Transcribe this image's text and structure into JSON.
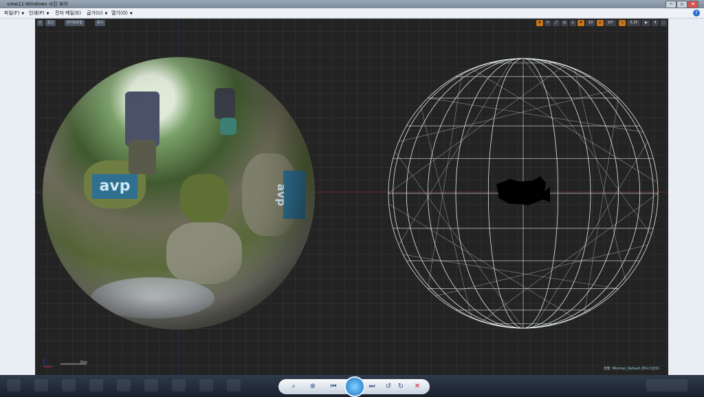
{
  "window": {
    "title": "view11-Windows 사진 뷰어"
  },
  "menu": {
    "items": [
      "파일(F)",
      "인쇄(P)",
      "전자 메일(E)",
      "굽기(U)",
      "열기(O)"
    ]
  },
  "viewport": {
    "left_toolbar": [
      "▾",
      "원근",
      "라이팅포함",
      "표시"
    ],
    "right_toolbar": [
      "10",
      "10°",
      "0.25",
      "4"
    ],
    "scale_label": "30m",
    "status": {
      "label": "레벨:",
      "value": "Minimal_Default (퍼시스턴트)"
    },
    "overlay_logo": "avp"
  },
  "bottom_controls": [
    "zoom-icon",
    "fit-icon",
    "previous-icon",
    "slideshow-icon",
    "next-icon",
    "rotate-ccw-icon",
    "rotate-cw-icon",
    "delete-icon"
  ]
}
